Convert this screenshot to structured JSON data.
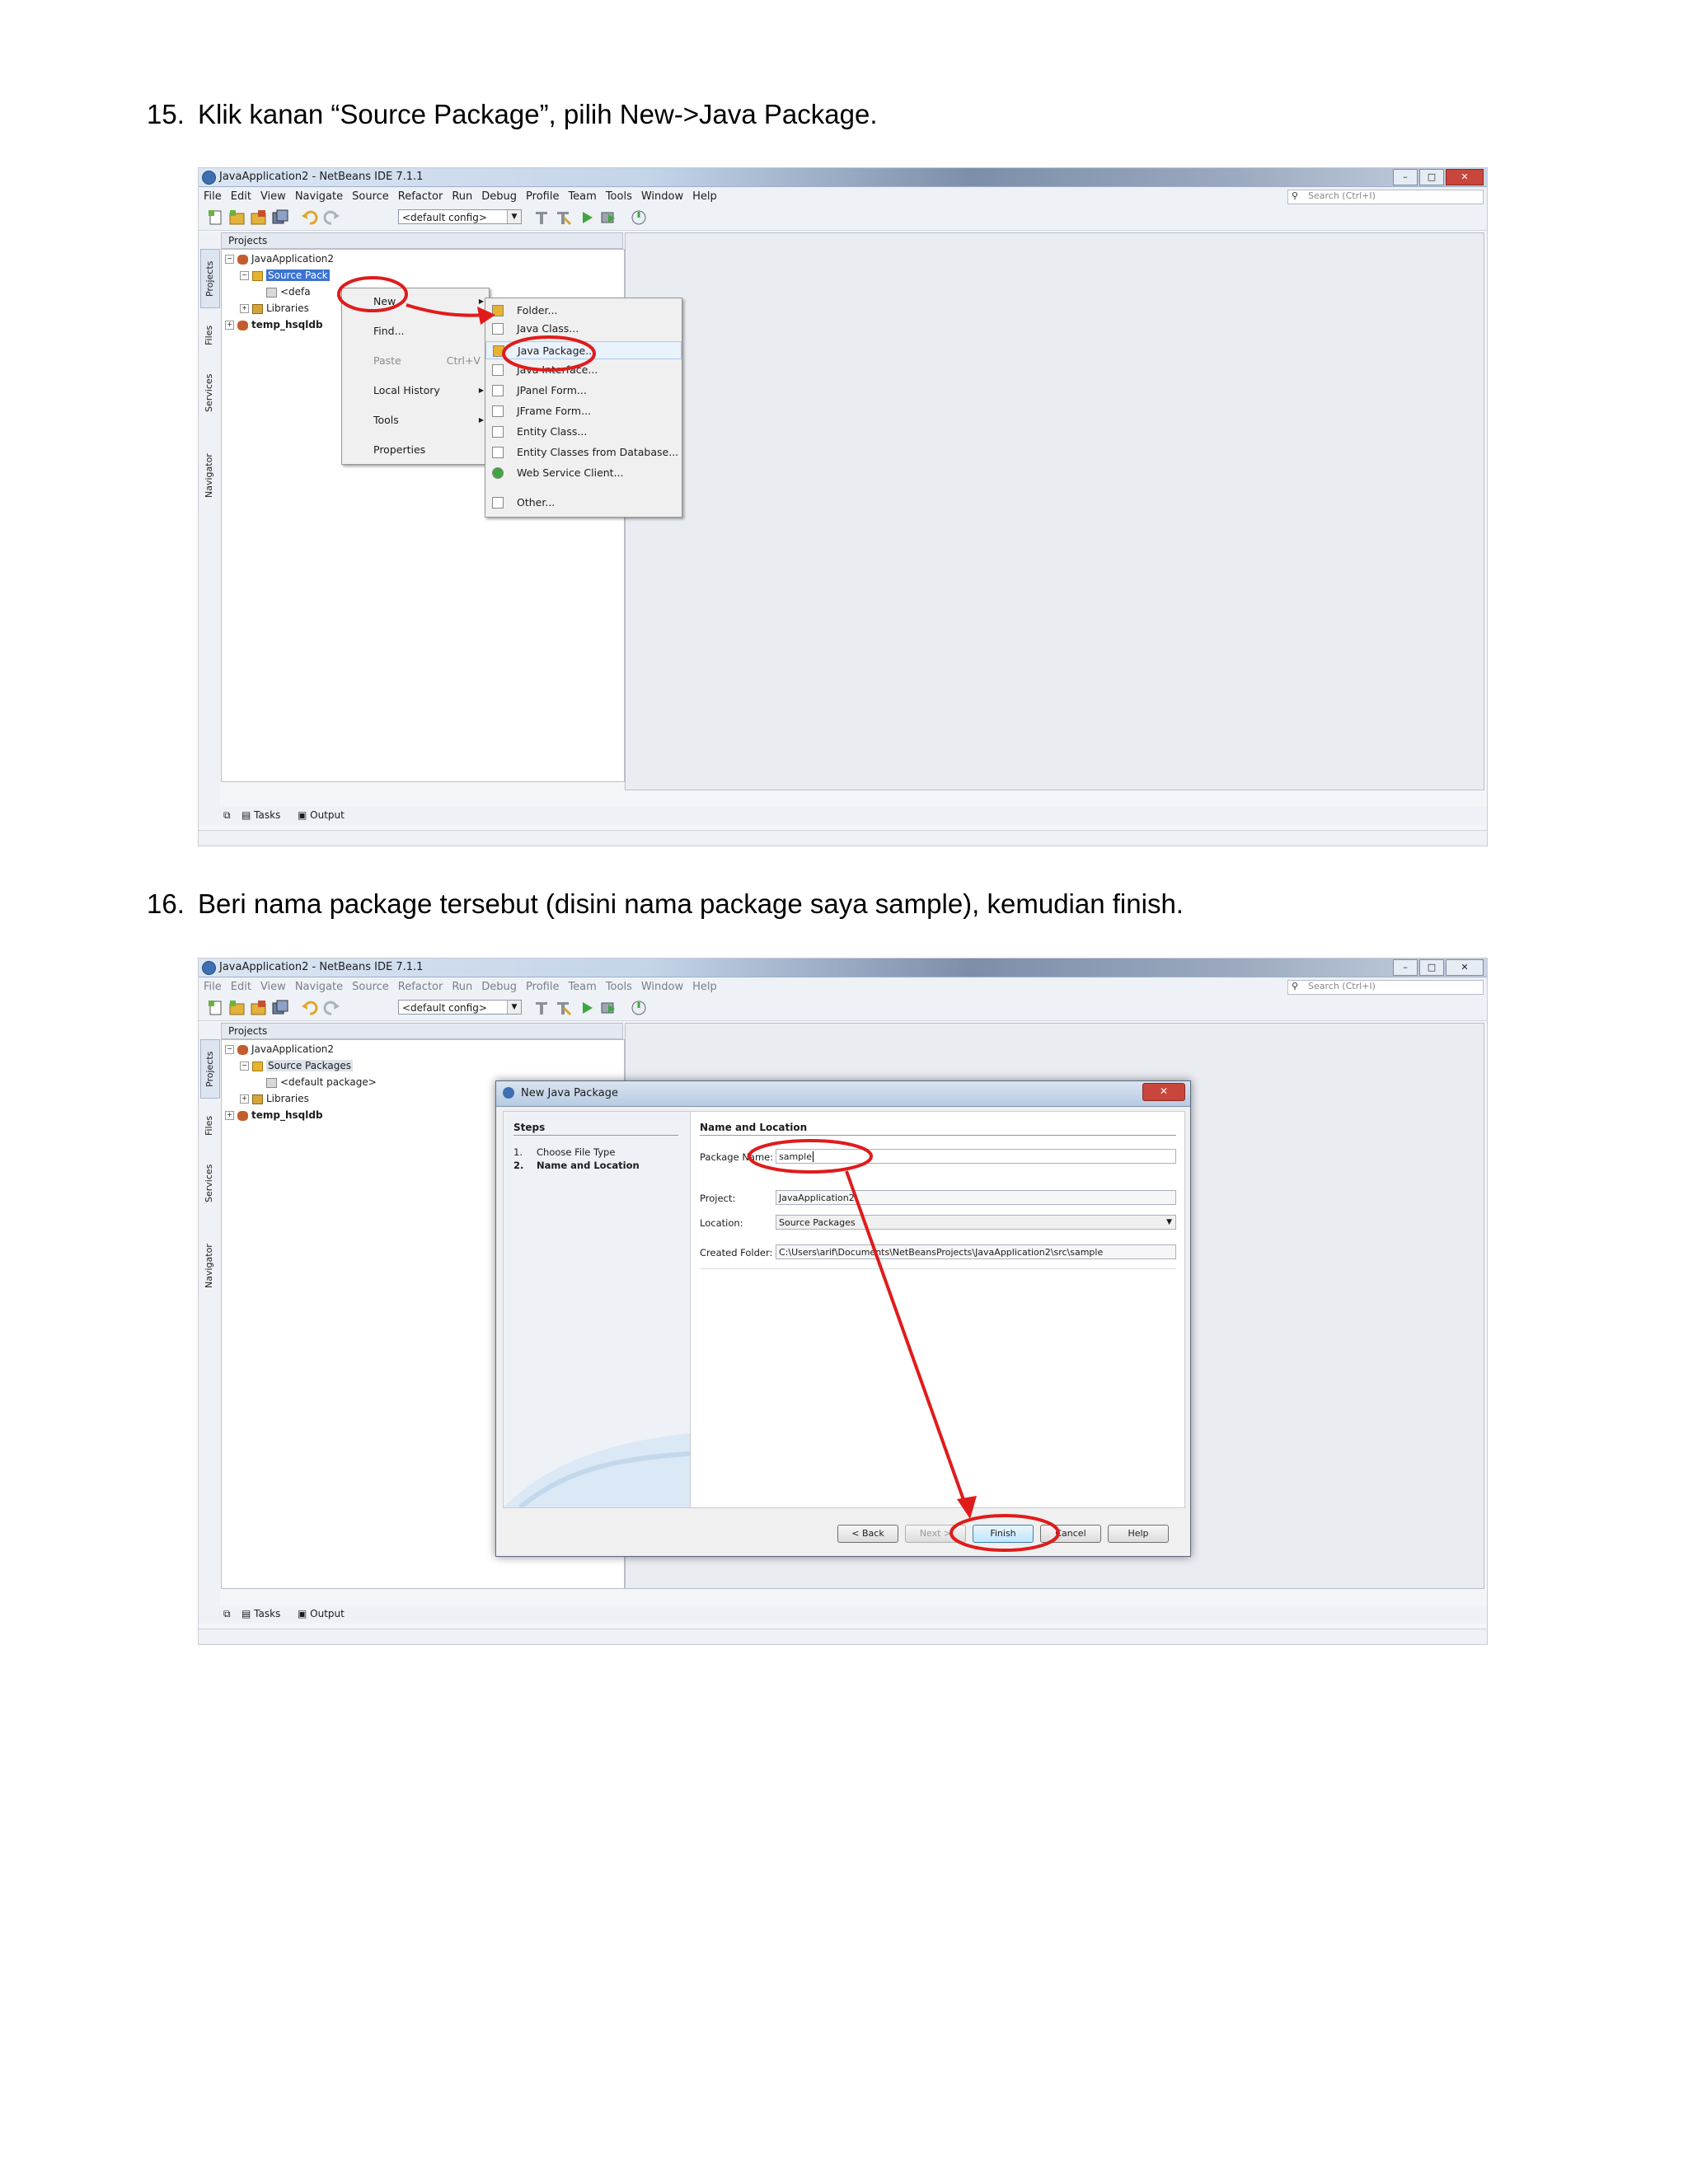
{
  "steps": [
    {
      "number": "15.",
      "text": "Klik kanan “Source Package”, pilih New->Java Package."
    },
    {
      "number": "16.",
      "text": "Beri nama package tersebut (disini nama package saya sample), kemudian finish."
    }
  ],
  "ide": {
    "window_title": "JavaApplication2 - NetBeans IDE 7.1.1",
    "menus": [
      "File",
      "Edit",
      "View",
      "Navigate",
      "Source",
      "Refactor",
      "Run",
      "Debug",
      "Profile",
      "Team",
      "Tools",
      "Window",
      "Help"
    ],
    "search_placeholder": "Search (Ctrl+I)",
    "config": "<default config>",
    "side_tabs": [
      "Projects",
      "Files",
      "Services",
      "Navigator"
    ],
    "projects_title": "Projects",
    "tree": {
      "project": "JavaApplication2",
      "source_packages": "Source Packages",
      "source_packages_truncated": "Source Pack",
      "default_package": "<default package>",
      "default_package_truncated": "<defa",
      "libraries": "Libraries",
      "other_project": "temp_hsqldb"
    },
    "bottom_tabs": [
      "Tasks",
      "Output"
    ]
  },
  "context_menu": {
    "items": [
      {
        "label": "New",
        "submenu": true
      },
      {
        "label": "Find..."
      },
      {
        "label": "Paste",
        "shortcut": "Ctrl+V",
        "disabled": true
      },
      {
        "label": "Local History",
        "submenu": true
      },
      {
        "label": "Tools",
        "submenu": true
      },
      {
        "label": "Properties"
      }
    ]
  },
  "new_submenu": {
    "items": [
      "Folder...",
      "Java Class...",
      "Java Package...",
      "Java Interface...",
      "JPanel Form...",
      "JFrame Form...",
      "Entity Class...",
      "Entity Classes from Database...",
      "Web Service Client...",
      "Other..."
    ],
    "highlighted": "Java Package..."
  },
  "dialog": {
    "title": "New Java Package",
    "steps_title": "Steps",
    "steps": [
      {
        "num": "1.",
        "label": "Choose File Type"
      },
      {
        "num": "2.",
        "label": "Name and Location"
      }
    ],
    "section_title": "Name and Location",
    "package_name_label": "Package Name:",
    "package_name_value": "sample",
    "project_label": "Project:",
    "project_value": "JavaApplication2",
    "location_label": "Location:",
    "location_value": "Source Packages",
    "created_folder_label": "Created Folder:",
    "created_folder_value": "C:\\Users\\arif\\Documents\\NetBeansProjects\\JavaApplication2\\src\\sample",
    "buttons": {
      "back": "< Back",
      "next": "Next >",
      "finish": "Finish",
      "cancel": "Cancel",
      "help": "Help"
    }
  },
  "colors": {
    "annotation": "#e01b1b",
    "selection": "#3b73d1"
  }
}
